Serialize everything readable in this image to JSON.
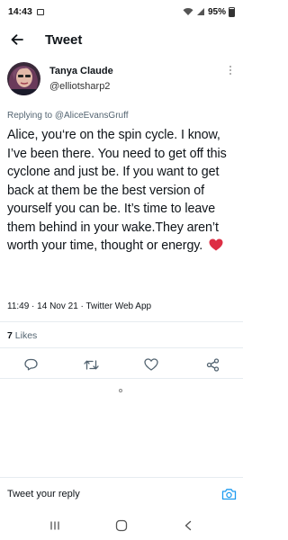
{
  "status_bar": {
    "time": "14:43",
    "battery": "95%",
    "icons": [
      "gallery-icon",
      "wifi-icon",
      "signal-icon",
      "battery-icon"
    ]
  },
  "header": {
    "title": "Tweet",
    "back_icon": "arrow-left-icon"
  },
  "author": {
    "display_name": "Tanya Claude",
    "handle": "@elliotsharp2"
  },
  "replying": {
    "prefix": "Replying to ",
    "mention": "@AliceEvansGruff"
  },
  "tweet": {
    "text": "Alice, you‘re  on the  spin cycle. I know, I’ve been there. You need to get off this cyclone and just be. If you want to get back at them be the best version of yourself you can be. It’s time to leave them behind  in your wake.They aren’t worth your time, thought or  energy.",
    "emoji": "red-heart-icon",
    "meta": "11:49 · 14 Nov 21 · Twitter Web App"
  },
  "likes": {
    "count": "7",
    "label": "Likes"
  },
  "actions": [
    "reply-icon",
    "retweet-icon",
    "like-icon",
    "share-icon"
  ],
  "reply_bar": {
    "placeholder": "Tweet your reply",
    "camera_icon": "camera-icon"
  },
  "nav_bar": [
    "recents-icon",
    "home-icon",
    "back-icon"
  ],
  "colors": {
    "text": "#0f1419",
    "secondary": "#536471",
    "accent": "#1d9bf0",
    "heart": "#dd2e44",
    "divider": "#e6ecf0"
  }
}
